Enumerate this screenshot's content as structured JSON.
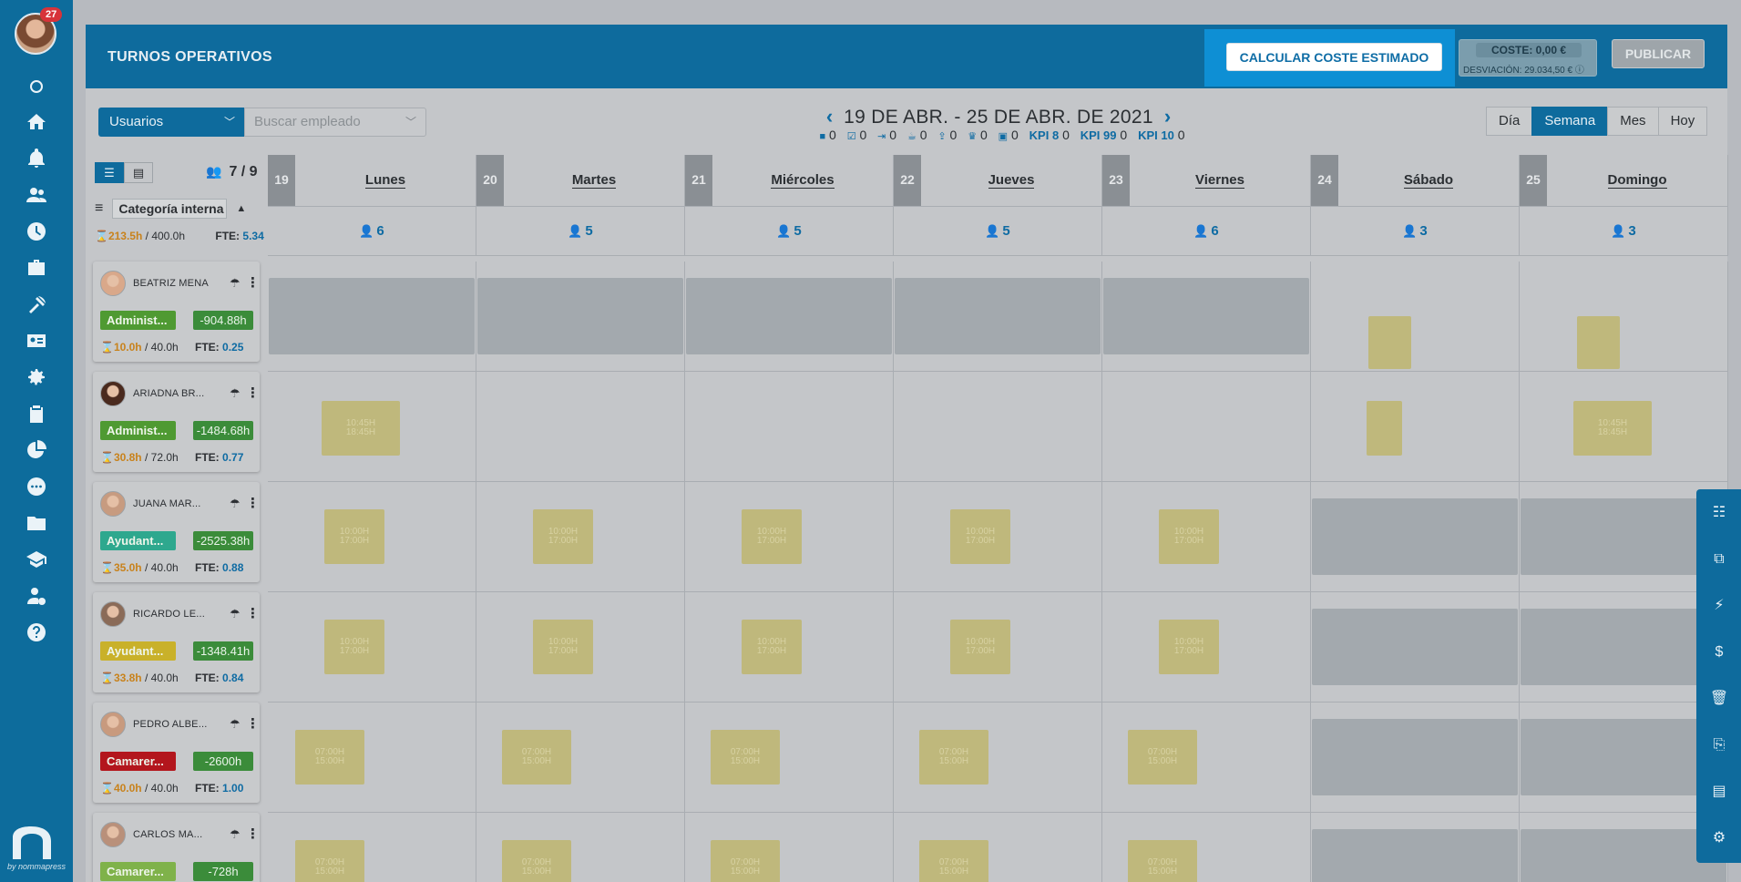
{
  "nav": {
    "notification_count": "27",
    "icons": [
      "circle-icon",
      "home-icon",
      "bell-icon",
      "users-icon",
      "clock-icon",
      "briefcase-icon",
      "beach-icon",
      "id-card-icon",
      "gear-icon",
      "clipboard-icon",
      "pie-chart-icon",
      "chat-icon",
      "folder-icon",
      "graduation-icon",
      "user-cost-icon",
      "help-icon"
    ],
    "brand_by": "by nommapress"
  },
  "header": {
    "title": "TURNOS OPERATIVOS",
    "calc_button": "CALCULAR COSTE ESTIMADO",
    "cost_label": "COSTE: 0,00 €",
    "deviation": "DESVIACIÓN: 29.034,50 €",
    "publish_button": "PUBLICAR"
  },
  "toolbar": {
    "filter_select": "Usuarios",
    "search_placeholder": "Buscar empleado",
    "date_range": "19 DE ABR. - 25 DE ABR. DE 2021",
    "stats": [
      {
        "icon": "briefcase-icon",
        "value": "0"
      },
      {
        "icon": "check-icon",
        "value": "0"
      },
      {
        "icon": "login-icon",
        "value": "0"
      },
      {
        "icon": "coffee-icon",
        "value": "0"
      },
      {
        "icon": "upload-icon",
        "value": "0"
      },
      {
        "icon": "trophy-icon",
        "value": "0"
      },
      {
        "icon": "bag-icon",
        "value": "0"
      }
    ],
    "kpis": [
      {
        "label": "KPI 8",
        "value": "0"
      },
      {
        "label": "KPI 99",
        "value": "0"
      },
      {
        "label": "KPI 10",
        "value": "0"
      }
    ],
    "views": [
      "Día",
      "Semana",
      "Mes",
      "Hoy"
    ],
    "active_view": "Semana"
  },
  "left_panel": {
    "users_count": "7 / 9",
    "sort_field": "Categoría interna",
    "total_hours": "213.5h",
    "total_capacity": "/ 400.0h",
    "fte_label": "FTE:",
    "fte_value": "5.34"
  },
  "days": [
    {
      "num": "19",
      "name": "Lunes",
      "count": "6"
    },
    {
      "num": "20",
      "name": "Martes",
      "count": "5"
    },
    {
      "num": "21",
      "name": "Miércoles",
      "count": "5"
    },
    {
      "num": "22",
      "name": "Jueves",
      "count": "5"
    },
    {
      "num": "23",
      "name": "Viernes",
      "count": "6"
    },
    {
      "num": "24",
      "name": "Sábado",
      "count": "3"
    },
    {
      "num": "25",
      "name": "Domingo",
      "count": "3"
    }
  ],
  "employees": [
    {
      "name": "BEATRIZ MENA",
      "tag": "Administ...",
      "tag_color": "#4f9a32",
      "balance": "-904.88h",
      "hours": "10.0h",
      "capacity": "/ 40.0h",
      "fte": "0.25"
    },
    {
      "name": "ARIADNA BR...",
      "tag": "Administ...",
      "tag_color": "#4f9a32",
      "balance": "-1484.68h",
      "hours": "30.8h",
      "capacity": "/ 72.0h",
      "fte": "0.77"
    },
    {
      "name": "JUANA MAR...",
      "tag": "Ayudant...",
      "tag_color": "#2ea88e",
      "balance": "-2525.38h",
      "hours": "35.0h",
      "capacity": "/ 40.0h",
      "fte": "0.88"
    },
    {
      "name": "RICARDO LE...",
      "tag": "Ayudant...",
      "tag_color": "#c9b12a",
      "balance": "-1348.41h",
      "hours": "33.8h",
      "capacity": "/ 40.0h",
      "fte": "0.84"
    },
    {
      "name": "PEDRO ALBE...",
      "tag": "Camarer...",
      "tag_color": "#b3161d",
      "balance": "-2600h",
      "hours": "40.0h",
      "capacity": "/ 40.0h",
      "fte": "1.00"
    },
    {
      "name": "CARLOS MA...",
      "tag": "Camarer...",
      "tag_color": "#7fb24a",
      "balance": "-728h",
      "hours": "",
      "capacity": "",
      "fte": ""
    }
  ],
  "shifts": [
    {
      "start": "10:45H",
      "end": "18:45H"
    },
    {
      "start": "10:00H",
      "end": "17:00H"
    },
    {
      "start": "07:00H",
      "end": "15:00H"
    }
  ],
  "right_rail": [
    "columns-icon",
    "copy-icon",
    "bolt-icon",
    "money-icon",
    "trash-icon",
    "pdf-icon",
    "document-icon",
    "settings-icon"
  ]
}
